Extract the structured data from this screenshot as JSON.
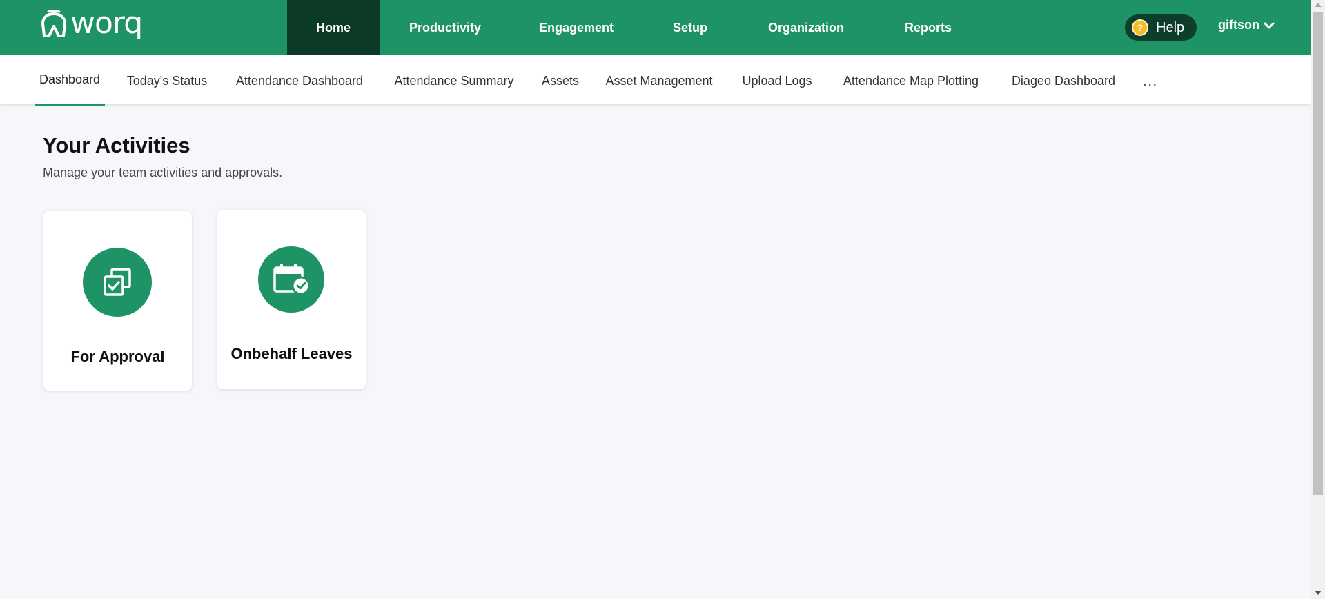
{
  "brand": {
    "name": "worq",
    "primary_color": "#1e9466",
    "active_nav_color": "#0b3a26"
  },
  "main_nav": [
    {
      "label": "Home",
      "active": true
    },
    {
      "label": "Productivity",
      "active": false
    },
    {
      "label": "Engagement",
      "active": false
    },
    {
      "label": "Setup",
      "active": false
    },
    {
      "label": "Organization",
      "active": false
    },
    {
      "label": "Reports",
      "active": false
    }
  ],
  "help": {
    "label": "Help",
    "icon": "question-icon",
    "badge": "?"
  },
  "user": {
    "name": "giftson",
    "icon": "chevron-down-icon"
  },
  "sub_nav": [
    {
      "label": "Dashboard",
      "active": true
    },
    {
      "label": "Today's Status",
      "active": false
    },
    {
      "label": "Attendance Dashboard",
      "active": false
    },
    {
      "label": "Attendance Summary",
      "active": false
    },
    {
      "label": "Assets",
      "active": false
    },
    {
      "label": "Asset Management",
      "active": false
    },
    {
      "label": "Upload Logs",
      "active": false
    },
    {
      "label": "Attendance Map Plotting",
      "active": false
    },
    {
      "label": "Diageo Dashboard",
      "active": false
    }
  ],
  "sub_nav_more": "...",
  "main": {
    "title": "Your Activities",
    "subtitle": "Manage your team activities and approvals.",
    "cards": [
      {
        "label": "For Approval",
        "icon": "approval-icon"
      },
      {
        "label": "Onbehalf Leaves",
        "icon": "calendar-check-icon"
      }
    ]
  }
}
